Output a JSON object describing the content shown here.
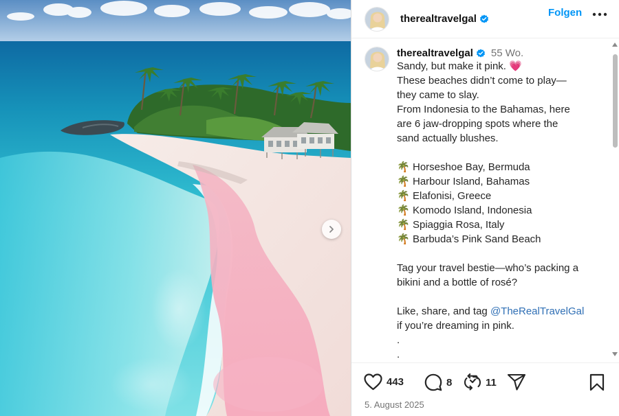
{
  "post": {
    "username": "therealtravelgal",
    "follow_label": "Folgen",
    "age": "55 Wo.",
    "caption_lines": [
      "Sandy, but make it pink. 💗",
      "These beaches didn’t come to play—",
      "they came to slay.",
      "From Indonesia to the Bahamas, here",
      "are 6 jaw-dropping spots where the",
      "sand actually blushes."
    ],
    "list": [
      "Horseshoe Bay, Bermuda",
      "Harbour Island, Bahamas",
      "Elafonisi, Greece",
      "Komodo Island, Indonesia",
      "Spiaggia Rosa, Italy",
      "Barbuda’s Pink Sand Beach"
    ],
    "question_lines": [
      "Tag your travel bestie—who’s packing a",
      "bikini and a bottle of rosé?"
    ],
    "cta_prefix": "Like, share, and tag ",
    "cta_mention": "@TheRealTravelGal",
    "cta_suffix": "if you’re dreaming in pink.",
    "trailing_dots": [
      "."
    ]
  },
  "stats": {
    "likes": "443",
    "comments": "8",
    "reposts": "11"
  },
  "date": "5. August 2025",
  "icons": {
    "verified": "verified-badge-icon",
    "more": "more-options-icon",
    "like": "heart-icon",
    "comment": "comment-icon",
    "repost": "repost-icon",
    "share": "send-icon",
    "save": "bookmark-icon",
    "palm": "palm-tree-icon",
    "next": "chevron-right-icon"
  },
  "colors": {
    "accent": "#0095f6",
    "verified": "#0095f6"
  }
}
